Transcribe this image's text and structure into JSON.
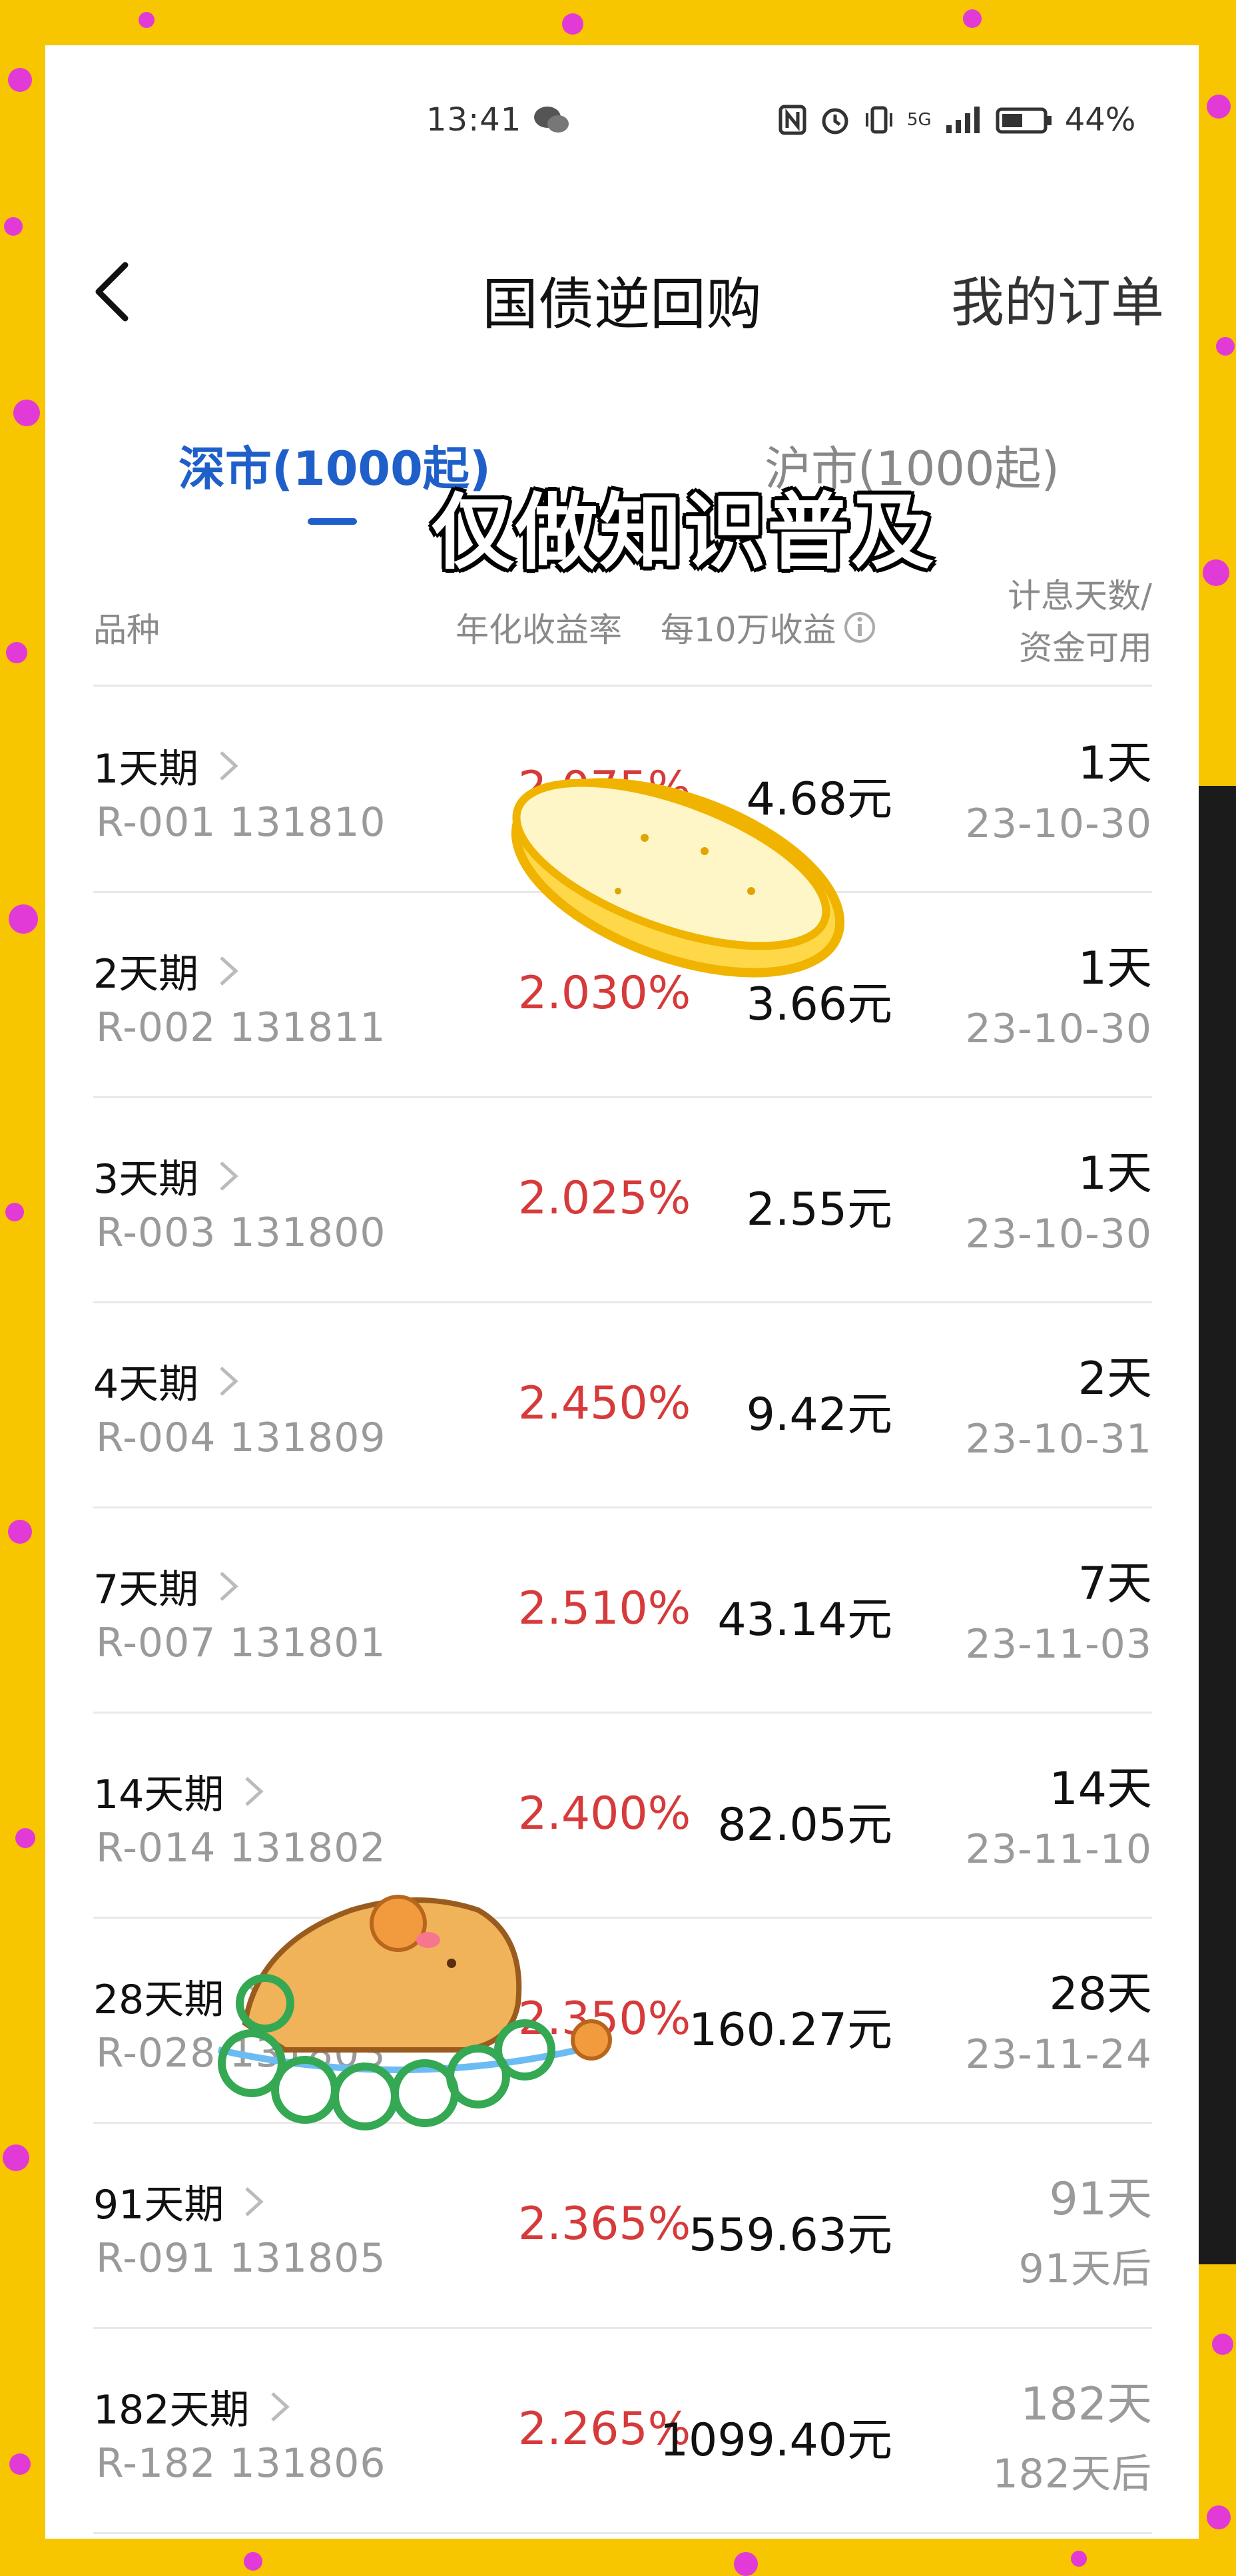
{
  "status_bar": {
    "time": "13:41",
    "network": "5G",
    "battery": "44%"
  },
  "header": {
    "title": "国债逆回购",
    "orders_link": "我的订单"
  },
  "tabs": [
    {
      "label": "深市(1000起)",
      "active": true
    },
    {
      "label": "沪市(1000起)",
      "active": false
    }
  ],
  "overlay": {
    "watermark": "仅做知识普及"
  },
  "table": {
    "headers": {
      "name": "品种",
      "rate": "年化收益率",
      "income": "每10万收益",
      "days_line1": "计息天数/",
      "days_line2": "资金可用"
    },
    "rows": [
      {
        "name": "1天期",
        "code": "R-001 131810",
        "rate": "2.075%",
        "income": "4.68元",
        "days": "1天",
        "date": "23-10-30"
      },
      {
        "name": "2天期",
        "code": "R-002 131811",
        "rate": "2.030%",
        "income": "3.66元",
        "days": "1天",
        "date": "23-10-30"
      },
      {
        "name": "3天期",
        "code": "R-003 131800",
        "rate": "2.025%",
        "income": "2.55元",
        "days": "1天",
        "date": "23-10-30"
      },
      {
        "name": "4天期",
        "code": "R-004 131809",
        "rate": "2.450%",
        "income": "9.42元",
        "days": "2天",
        "date": "23-10-31"
      },
      {
        "name": "7天期",
        "code": "R-007 131801",
        "rate": "2.510%",
        "income": "43.14元",
        "days": "7天",
        "date": "23-11-03"
      },
      {
        "name": "14天期",
        "code": "R-014 131802",
        "rate": "2.400%",
        "income": "82.05元",
        "days": "14天",
        "date": "23-11-10"
      },
      {
        "name": "28天期",
        "code": "R-028 131803",
        "rate": "2.350%",
        "income": "160.27元",
        "days": "28天",
        "date": "23-11-24"
      },
      {
        "name": "91天期",
        "code": "R-091 131805",
        "rate": "2.365%",
        "income": "559.63元",
        "days": "91天",
        "date": "91天后"
      },
      {
        "name": "182天期",
        "code": "R-182 131806",
        "rate": "2.265%",
        "income": "1099.40元",
        "days": "182天",
        "date": "182天后"
      }
    ]
  },
  "colors": {
    "accent_blue": "#1f5fc9",
    "rate_red": "#d63a3a",
    "background_yellow": "#f7c600",
    "dot_magenta": "#e23ad6"
  },
  "icons": [
    "wechat-icon",
    "nfc-icon",
    "alarm-icon",
    "vibrate-icon",
    "signal-icon",
    "battery-icon",
    "back-icon",
    "chevron-right-icon",
    "info-icon"
  ]
}
